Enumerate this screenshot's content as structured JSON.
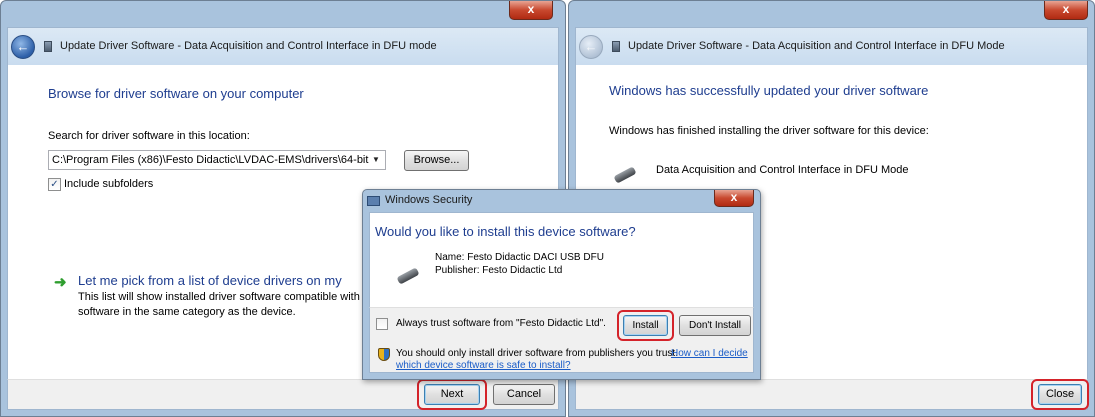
{
  "left_window": {
    "title": "Update Driver Software - Data Acquisition and Control Interface in DFU mode",
    "close_label": "x",
    "heading": "Browse for driver software on your computer",
    "search_label": "Search for driver software in this location:",
    "path_value": "C:\\Program Files (x86)\\Festo Didactic\\LVDAC-EMS\\drivers\\64-bit",
    "browse_label": "Browse...",
    "include_subfolders_label": "Include subfolders",
    "include_subfolders_checked": true,
    "pick_link": "Let me pick from a list of device drivers on my",
    "pick_desc_line1": "This list will show installed driver software compatible with th",
    "pick_desc_line2": "software in the same category as the device.",
    "next_label": "Next",
    "cancel_label": "Cancel"
  },
  "right_window": {
    "title": "Update Driver Software - Data Acquisition and Control Interface in DFU Mode",
    "close_label": "x",
    "heading": "Windows has successfully updated your driver software",
    "message": "Windows has finished installing the driver software for this device:",
    "device_name": "Data Acquisition and Control Interface in DFU Mode",
    "close_button_label": "Close"
  },
  "security_dialog": {
    "title": "Windows Security",
    "close_label": "x",
    "question": "Would you like to install this device software?",
    "name_line": "Name: Festo Didactic DACI USB DFU",
    "publisher_line": "Publisher: Festo Didactic Ltd",
    "always_trust_label": "Always trust software from \"Festo Didactic Ltd\".",
    "install_label": "Install",
    "dont_install_label": "Don't Install",
    "warning_text": "You should only install driver software from publishers you trust.",
    "help_link_line1": "How can I decide",
    "help_link_line2": "which device software is safe to install?"
  },
  "colors": {
    "highlight": "#d4232a",
    "heading_blue": "#1e3d8f",
    "link_blue": "#1a5cc7",
    "frame": "#a9c3dd"
  }
}
